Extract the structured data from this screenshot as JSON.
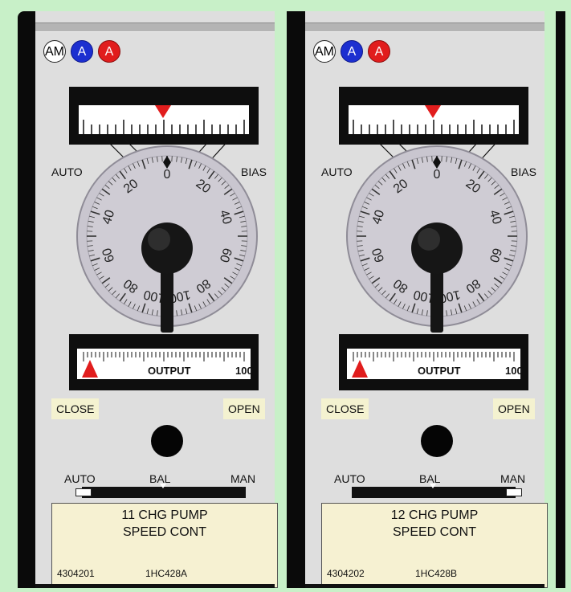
{
  "panels": [
    {
      "lamps": {
        "am": "AM",
        "a1": "A",
        "a2": "A"
      },
      "auto_label": "AUTO",
      "bias_label": "BIAS",
      "dial_numbers": [
        "0",
        "20",
        "20",
        "40",
        "40",
        "60",
        "60",
        "80",
        "80",
        "100",
        "100"
      ],
      "output_label": "OUTPUT",
      "output_max": "100",
      "output_value": 0,
      "close_label": "CLOSE",
      "open_label": "OPEN",
      "sw_auto": "AUTO",
      "sw_bal": "BAL",
      "sw_man": "MAN",
      "switch_position": "AUTO",
      "name_line1": "11 CHG PUMP",
      "name_line2": "SPEED CONT",
      "id": "4304201",
      "tag": "1HC428A"
    },
    {
      "lamps": {
        "am": "AM",
        "a1": "A",
        "a2": "A"
      },
      "auto_label": "AUTO",
      "bias_label": "BIAS",
      "dial_numbers": [
        "0",
        "20",
        "20",
        "40",
        "40",
        "60",
        "60",
        "80",
        "80",
        "100",
        "100"
      ],
      "output_label": "OUTPUT",
      "output_max": "100",
      "output_value": 0,
      "close_label": "CLOSE",
      "open_label": "OPEN",
      "sw_auto": "AUTO",
      "sw_bal": "BAL",
      "sw_man": "MAN",
      "switch_position": "MAN",
      "name_line1": "12 CHG PUMP",
      "name_line2": "SPEED CONT",
      "id": "4304202",
      "tag": "1HC428B"
    }
  ],
  "colors": {
    "background": "#c8f0c8",
    "face": "#dedede",
    "indicator": "#e11d1d",
    "lamp_blue": "#1c2fd0",
    "lamp_red": "#e11d1d",
    "nameplate": "#f6f1d2",
    "tag": "#f4f2d0"
  }
}
